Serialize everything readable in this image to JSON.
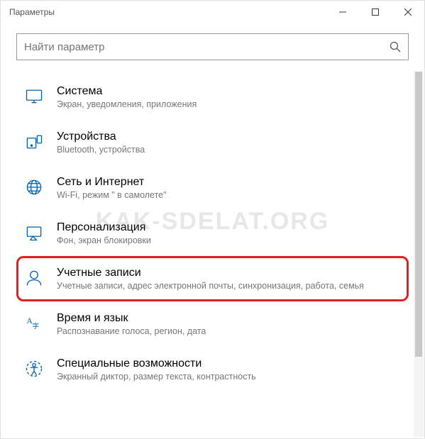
{
  "window": {
    "title": "Параметры"
  },
  "search": {
    "placeholder": "Найти параметр"
  },
  "categories": [
    {
      "id": "system",
      "title": "Система",
      "desc": "Экран, уведомления, приложения",
      "highlight": false
    },
    {
      "id": "devices",
      "title": "Устройства",
      "desc": "Bluetooth, устройства",
      "highlight": false
    },
    {
      "id": "network",
      "title": "Сеть и Интернет",
      "desc": "Wi-Fi, режим \" в самолете\"",
      "highlight": false
    },
    {
      "id": "personalization",
      "title": "Персонализация",
      "desc": "Фон, экран блокировки",
      "highlight": false
    },
    {
      "id": "accounts",
      "title": "Учетные записи",
      "desc": "Учетные записи, адрес электронной почты, синхронизация, работа, семья",
      "highlight": true
    },
    {
      "id": "timelang",
      "title": "Время и язык",
      "desc": "Распознавание голоса, регион, дата",
      "highlight": false
    },
    {
      "id": "ease",
      "title": "Специальные возможности",
      "desc": "Экранный диктор, размер текста, контрастность",
      "highlight": false
    }
  ],
  "watermark": "KAK-SDELAT.ORG"
}
